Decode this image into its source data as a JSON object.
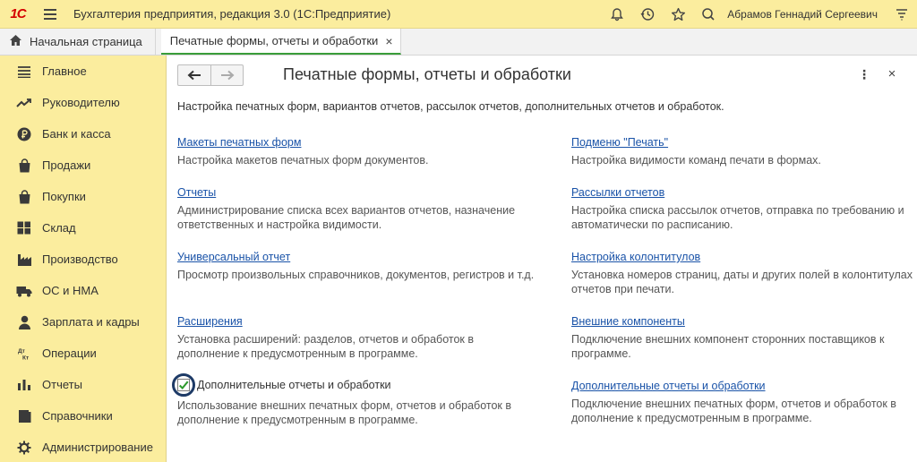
{
  "app": {
    "logo": "1С",
    "title": "Бухгалтерия предприятия, редакция 3.0  (1С:Предприятие)",
    "user": "Абрамов Геннадий Сергеевич"
  },
  "tabs": {
    "home": "Начальная страница",
    "active": "Печатные формы, отчеты и обработки",
    "close": "×"
  },
  "sidebar": {
    "items": [
      {
        "label": "Главное",
        "icon": "list-icon"
      },
      {
        "label": "Руководителю",
        "icon": "trend-icon"
      },
      {
        "label": "Банк и касса",
        "icon": "ruble-icon"
      },
      {
        "label": "Продажи",
        "icon": "bag-icon"
      },
      {
        "label": "Покупки",
        "icon": "cart-icon"
      },
      {
        "label": "Склад",
        "icon": "warehouse-icon"
      },
      {
        "label": "Производство",
        "icon": "factory-icon"
      },
      {
        "label": "ОС и НМА",
        "icon": "truck-icon"
      },
      {
        "label": "Зарплата и кадры",
        "icon": "person-icon"
      },
      {
        "label": "Операции",
        "icon": "dt-kt-icon"
      },
      {
        "label": "Отчеты",
        "icon": "bar-chart-icon"
      },
      {
        "label": "Справочники",
        "icon": "book-icon"
      },
      {
        "label": "Администрирование",
        "icon": "gear-icon"
      }
    ]
  },
  "main": {
    "title": "Печатные формы, отчеты и обработки",
    "subtitle": "Настройка печатных форм, вариантов отчетов, рассылок отчетов, дополнительных отчетов и обработок.",
    "more": "⋮",
    "close": "×",
    "left": [
      {
        "link": "Макеты печатных форм",
        "desc": "Настройка макетов печатных форм документов."
      },
      {
        "link": "Отчеты",
        "desc": "Администрирование списка всех вариантов отчетов, назначение\nответственных и настройка видимости."
      },
      {
        "link": "Универсальный отчет",
        "desc": "Просмотр произвольных справочников, документов, регистров и т.д."
      },
      {
        "link": "Расширения",
        "desc": "Установка расширений: разделов, отчетов и обработок в\nдополнение к предусмотренным в программе."
      },
      {
        "checkbox_label": "Дополнительные отчеты и обработки",
        "checked": true,
        "desc": "Использование внешних печатных форм, отчетов и обработок в\nдополнение к предусмотренным в программе."
      }
    ],
    "right": [
      {
        "link": "Подменю \"Печать\"",
        "desc": "Настройка видимости команд печати в формах."
      },
      {
        "link": "Рассылки отчетов",
        "desc": "Настройка списка рассылок отчетов, отправка по требованию и\nавтоматически по расписанию."
      },
      {
        "link": "Настройка колонтитулов",
        "desc": "Установка номеров страниц, даты и других полей в колонтитулах\nотчетов при печати."
      },
      {
        "link": "Внешние компоненты",
        "desc": "Подключение внешних компонент сторонних поставщиков к\nпрограмме."
      },
      {
        "link": "Дополнительные отчеты и обработки",
        "desc": "Подключение внешних печатных форм, отчетов и обработок в\nдополнение к предусмотренным в программе."
      }
    ]
  },
  "colors": {
    "panel": "#fbed9e",
    "link": "#1a53a8",
    "check": "#2e9a2e",
    "highlight_ring": "#1d3a66",
    "active_tab": "#3a9d3a"
  }
}
